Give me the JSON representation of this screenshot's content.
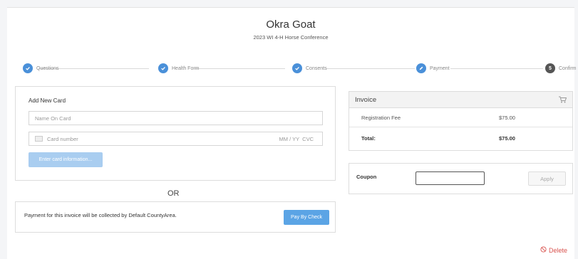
{
  "header": {
    "title": "Okra Goat",
    "subtitle": "2023 WI 4-H Horse Conference"
  },
  "steps": [
    {
      "label": "Questions",
      "state": "complete"
    },
    {
      "label": "Health Form",
      "state": "complete"
    },
    {
      "label": "Consents",
      "state": "complete"
    },
    {
      "label": "Payment",
      "state": "current"
    },
    {
      "label": "Confirm",
      "number": "5",
      "state": "pending"
    }
  ],
  "card_form": {
    "heading": "Add New Card",
    "name_placeholder": "Name On Card",
    "card_placeholder": "Card number",
    "expiry_cvc_placeholder": "MM / YY  CVC",
    "submit_label": "Enter card information..."
  },
  "or_label": "OR",
  "check_payment": {
    "message": "Payment for this invoice will be collected by Default CountyArea.",
    "button_label": "Pay By Check"
  },
  "invoice": {
    "title": "Invoice",
    "lines": [
      {
        "label": "Registration Fee",
        "amount": "$75.00"
      }
    ],
    "total_label": "Total:",
    "total_amount": "$75.00"
  },
  "coupon": {
    "label": "Coupon",
    "value": "",
    "apply_label": "Apply"
  },
  "delete_label": "Delete",
  "colors": {
    "accent": "#5ba4e5",
    "step_done": "#4a90d9",
    "danger": "#d9534f"
  }
}
